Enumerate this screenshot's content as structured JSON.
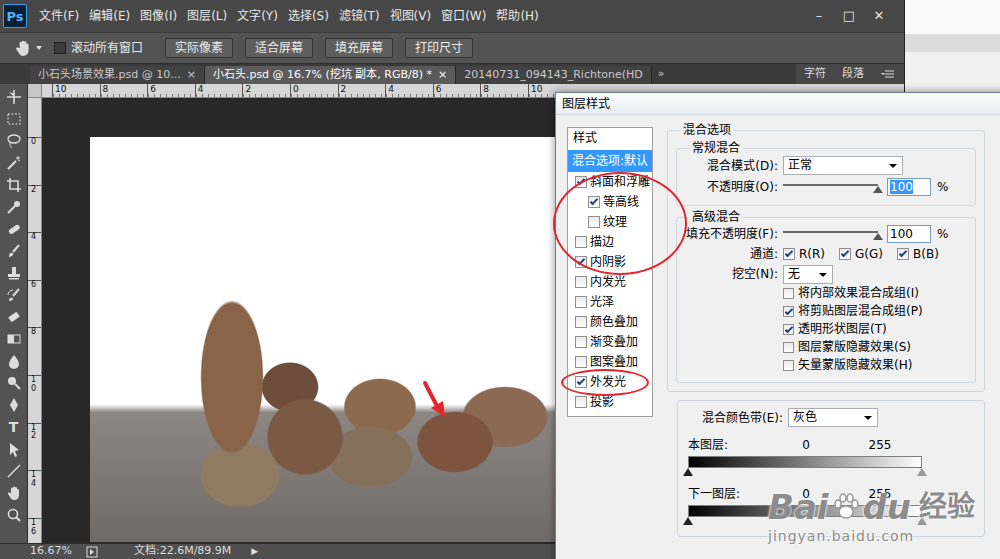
{
  "app": {
    "logo": "Ps",
    "menu": [
      "文件(F)",
      "编辑(E)",
      "图像(I)",
      "图层(L)",
      "文字(Y)",
      "选择(S)",
      "滤镜(T)",
      "视图(V)",
      "窗口(W)",
      "帮助(H)"
    ],
    "window_controls": [
      "–",
      "□",
      "✕"
    ]
  },
  "options_bar": {
    "scroll_all": {
      "label": "滚动所有窗口",
      "checked": false
    },
    "buttons": [
      "实际像素",
      "适合屏幕",
      "填充屏幕",
      "打印尺寸"
    ]
  },
  "doc_tabs": [
    {
      "label": "小石头场景效果.psd @ 10...",
      "close": "×",
      "selected": false
    },
    {
      "label": "小石头.psd @ 16.7% (挖坑 副本, RGB/8) *",
      "close": "×",
      "selected": true
    },
    {
      "label": "20140731_094143_Richtone(HD",
      "selected": false
    }
  ],
  "tabs_overflow": "»",
  "panel_tabs": [
    {
      "label": "字符",
      "selected": false
    },
    {
      "label": "段落",
      "selected": false
    }
  ],
  "ruler": {
    "top": [
      "10",
      "8",
      "6",
      "4",
      "2",
      "0",
      "2",
      "4",
      "6",
      "8",
      "10"
    ],
    "left": [
      "0",
      "2",
      "4",
      "6",
      "8",
      "10",
      "12",
      "14",
      "16"
    ]
  },
  "tools": {
    "type_glyph": "T"
  },
  "status_bar": {
    "zoom": "16.67%",
    "doc": "文档:22.6M/89.9M",
    "arrow": "▶"
  },
  "dialog": {
    "title": "图层样式",
    "styles_header": "样式",
    "styles": [
      {
        "label": "混合选项:默认",
        "kind": "option",
        "selected": true
      },
      {
        "label": "斜面和浮雕",
        "kind": "check",
        "checked": true,
        "selected": false
      },
      {
        "label": "等高线",
        "kind": "sub",
        "checked": true,
        "selected": false
      },
      {
        "label": "纹理",
        "kind": "sub",
        "checked": false,
        "selected": false
      },
      {
        "label": "描边",
        "kind": "check",
        "checked": false,
        "selected": false
      },
      {
        "label": "内阴影",
        "kind": "check",
        "checked": true,
        "selected": false
      },
      {
        "label": "内发光",
        "kind": "check",
        "checked": false,
        "selected": false
      },
      {
        "label": "光泽",
        "kind": "check",
        "checked": false,
        "selected": false
      },
      {
        "label": "颜色叠加",
        "kind": "check",
        "checked": false,
        "selected": false
      },
      {
        "label": "渐变叠加",
        "kind": "check",
        "checked": false,
        "selected": false
      },
      {
        "label": "图案叠加",
        "kind": "check",
        "checked": false,
        "selected": false
      },
      {
        "label": "外发光",
        "kind": "check",
        "checked": true,
        "selected": false
      },
      {
        "label": "投影",
        "kind": "check",
        "checked": false,
        "selected": false
      }
    ],
    "blending": {
      "title": "混合选项",
      "general": {
        "title": "常规混合",
        "mode": {
          "label": "混合模式(D):",
          "value": "正常"
        },
        "opacity": {
          "label": "不透明度(O):",
          "level": 1,
          "value": "100",
          "unit": "%",
          "focused": true
        }
      },
      "advanced": {
        "title": "高级混合",
        "fill": {
          "label": "填充不透明度(F):",
          "level": 1,
          "value": "100",
          "unit": "%",
          "focused": false
        },
        "channels": {
          "label": "通道:",
          "items": [
            {
              "label": "R(R)",
              "checked": true
            },
            {
              "label": "G(G)",
              "checked": true
            },
            {
              "label": "B(B)",
              "checked": true
            }
          ]
        },
        "knockout": {
          "label": "挖空(N):",
          "value": "无"
        },
        "options": [
          {
            "label": "将内部效果混合成组(I)",
            "checked": false
          },
          {
            "label": "将剪贴图层混合成组(P)",
            "checked": true
          },
          {
            "label": "透明形状图层(T)",
            "checked": true
          },
          {
            "label": "图层蒙版隐藏效果(S)",
            "checked": false
          },
          {
            "label": "矢量蒙版隐藏效果(H)",
            "checked": false
          }
        ]
      }
    },
    "blend_if": {
      "label": "混合颜色带(E):",
      "value": "灰色",
      "bands": [
        {
          "label": "本图层:",
          "min": "0",
          "max": "255",
          "black_level": 0,
          "white_level": 1
        },
        {
          "label": "下一图层:",
          "min": "0",
          "max": "255",
          "black_level": 0,
          "white_level": 1
        }
      ]
    }
  },
  "watermark": {
    "brand_a": "Bai",
    "brand_b": "du",
    "label": "经验",
    "url": "jingyan.baidu.com"
  }
}
